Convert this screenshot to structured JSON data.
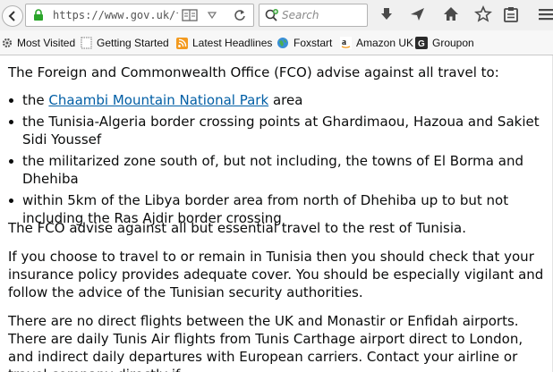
{
  "browser": {
    "url": "https://www.gov.uk/forei",
    "search_placeholder": "Search"
  },
  "bookmarks": [
    {
      "label": "Most Visited",
      "icon": "gear-icon"
    },
    {
      "label": "Getting Started",
      "icon": "page-icon"
    },
    {
      "label": "Latest Headlines",
      "icon": "rss-icon"
    },
    {
      "label": "Foxstart",
      "icon": "globe-icon"
    },
    {
      "label": "Amazon UK",
      "icon": "amazon-icon"
    },
    {
      "label": "Groupon",
      "icon": "groupon-icon"
    }
  ],
  "article": {
    "intro": "The Foreign and Commonwealth Office (FCO) advise against all travel to:",
    "bullets": {
      "b1_pre": "the ",
      "b1_link": "Chaambi Mountain National Park",
      "b1_post": " area",
      "b2": "the Tunisia-Algeria border crossing points at Ghardimaou, Hazoua and Sakiet Sidi Youssef",
      "b3": "the militarized zone south of, but not including, the towns of El Borma and Dhehiba",
      "b4": "within 5km of the Libya border area from north of Dhehiba up to but not including the Ras Ajdir border crossing"
    },
    "para2": "The FCO advise against all but essential travel to the rest of Tunisia.",
    "para3": "If you choose to travel to or remain in Tunisia then you should check that your insurance policy provides adequate cover. You should be especially vigilant and follow the advice of the Tunisian security authorities.",
    "para4": "There are no direct flights between the UK and Monastir or Enfidah airports. There are daily Tunis Air flights from Tunis Carthage airport direct to London, and indirect daily departures with European carriers. Contact your airline or travel company directly if"
  },
  "colors": {
    "link": "#005ea5",
    "lock": "#2aa52a"
  }
}
